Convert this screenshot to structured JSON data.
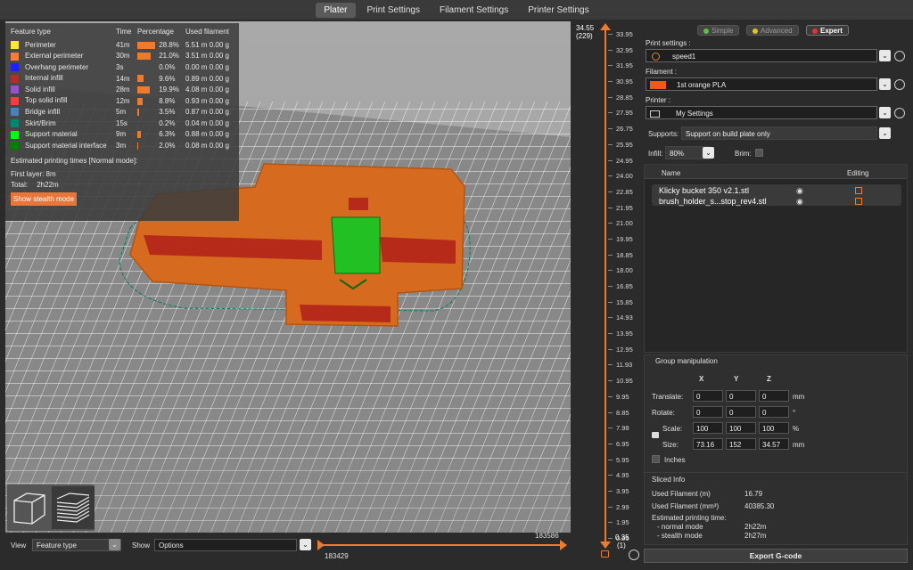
{
  "tabs": [
    {
      "label": "Plater",
      "active": true
    },
    {
      "label": "Print Settings",
      "active": false
    },
    {
      "label": "Filament Settings",
      "active": false
    },
    {
      "label": "Printer Settings",
      "active": false
    }
  ],
  "legend": {
    "headers": [
      "Feature type",
      "Time",
      "Percentage",
      "Used filament"
    ],
    "rows": [
      {
        "name": "Perimeter",
        "color": "#ffe63c",
        "time": "41m",
        "pct": "28.8%",
        "pct_value": 28.8,
        "len": "5.51 m",
        "weight": "0.00 g"
      },
      {
        "name": "External perimeter",
        "color": "#ff7d38",
        "time": "30m",
        "pct": "21.0%",
        "pct_value": 21.0,
        "len": "3.51 m",
        "weight": "0.00 g"
      },
      {
        "name": "Overhang perimeter",
        "color": "#1f1fff",
        "time": "3s",
        "pct": "0.0%",
        "pct_value": 0.0,
        "len": "0.00 m",
        "weight": "0.00 g"
      },
      {
        "name": "Internal infill",
        "color": "#b03029",
        "time": "14m",
        "pct": "9.6%",
        "pct_value": 9.6,
        "len": "0.89 m",
        "weight": "0.00 g"
      },
      {
        "name": "Solid infill",
        "color": "#9654cc",
        "time": "28m",
        "pct": "19.9%",
        "pct_value": 19.9,
        "len": "4.08 m",
        "weight": "0.00 g"
      },
      {
        "name": "Top solid infill",
        "color": "#f04040",
        "time": "12m",
        "pct": "8.8%",
        "pct_value": 8.8,
        "len": "0.93 m",
        "weight": "0.00 g"
      },
      {
        "name": "Bridge infill",
        "color": "#4d80ba",
        "time": "5m",
        "pct": "3.5%",
        "pct_value": 3.5,
        "len": "0.87 m",
        "weight": "0.00 g"
      },
      {
        "name": "Skirt/Brim",
        "color": "#00876e",
        "time": "15s",
        "pct": "0.2%",
        "pct_value": 0.2,
        "len": "0.04 m",
        "weight": "0.00 g"
      },
      {
        "name": "Support material",
        "color": "#00ff00",
        "time": "9m",
        "pct": "6.3%",
        "pct_value": 6.3,
        "len": "0.88 m",
        "weight": "0.00 g"
      },
      {
        "name": "Support material interface",
        "color": "#008000",
        "time": "3m",
        "pct": "2.0%",
        "pct_value": 2.0,
        "len": "0.08 m",
        "weight": "0.00 g"
      }
    ],
    "estimated_title": "Estimated printing times [Normal mode]:",
    "first_layer": "First layer: 8m",
    "total_label": "Total:",
    "total_value": "2h22m",
    "stealth_button": "Show stealth mode"
  },
  "bottom": {
    "view_label": "View",
    "view_value": "Feature type",
    "show_label": "Show",
    "show_value": "Options",
    "h_slider_right": "183586",
    "h_slider_left": "183429"
  },
  "vslider": {
    "top_value": "34.55",
    "top_layer": "(229)",
    "bottom_value": "0.35",
    "bottom_layer": "(1)",
    "ticks": [
      "33.95",
      "32.95",
      "31.95",
      "30.95",
      "28.85",
      "27.95",
      "26.75",
      "25.95",
      "24.95",
      "24.00",
      "22.85",
      "21.95",
      "21.00",
      "19.95",
      "18.85",
      "18.00",
      "16.85",
      "15.85",
      "14.93",
      "13.95",
      "12.95",
      "11.93",
      "10.95",
      "9.95",
      "8.85",
      "7.98",
      "6.95",
      "5.95",
      "4.95",
      "3.95",
      "2.99",
      "1.95",
      "0.95"
    ]
  },
  "panel": {
    "modes": {
      "simple": "Simple",
      "advanced": "Advanced",
      "expert": "Expert"
    },
    "print_settings_label": "Print settings :",
    "print_settings_value": "speed1",
    "filament_label": "Filament :",
    "filament_value": "1st orange PLA",
    "filament_color": "#ee5a1a",
    "printer_label": "Printer :",
    "printer_value": "My Settings",
    "supports_label": "Supports:",
    "supports_value": "Support on build plate only",
    "infill_label": "Infill:",
    "infill_value": "80%",
    "brim_label": "Brim:",
    "objects_col_name": "Name",
    "objects_col_editing": "Editing",
    "objects": [
      {
        "name": "Klicky bucket 350 v2.1.stl"
      },
      {
        "name": "brush_holder_s...stop_rev4.stl"
      }
    ],
    "group": {
      "title": "Group manipulation",
      "axes": [
        "X",
        "Y",
        "Z"
      ],
      "translate_label": "Translate:",
      "translate": [
        "0",
        "0",
        "0"
      ],
      "translate_unit": "mm",
      "rotate_label": "Rotate:",
      "rotate": [
        "0",
        "0",
        "0"
      ],
      "rotate_unit": "°",
      "scale_label": "Scale:",
      "scale": [
        "100",
        "100",
        "100"
      ],
      "scale_unit": "%",
      "size_label": "Size:",
      "size": [
        "73.16",
        "152",
        "34.57"
      ],
      "size_unit": "mm",
      "inches_label": "Inches"
    },
    "sliced": {
      "title": "Sliced Info",
      "used_m_label": "Used Filament (m)",
      "used_m": "16.79",
      "used_mm3_label": "Used Filament (mm³)",
      "used_mm3": "40385.30",
      "est_label": "Estimated printing time:",
      "normal_label": "- normal mode",
      "normal": "2h22m",
      "stealth_label": "- stealth mode",
      "stealth": "2h27m"
    },
    "export_button": "Export G-code"
  }
}
